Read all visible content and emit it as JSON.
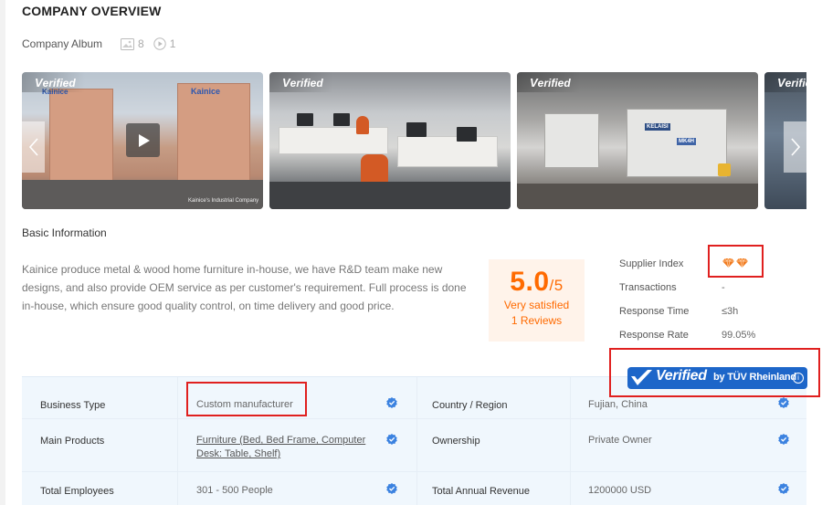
{
  "title": "COMPANY OVERVIEW",
  "album": {
    "label": "Company Album",
    "image_count": "8",
    "video_count": "1"
  },
  "gallery": {
    "verified_label_prefix": "V",
    "verified_label_rest": "erified",
    "photo1_sign": "Kainice",
    "photo1_caption": "Kainice's Industrial Company",
    "photo3_machine_label": "MK4H",
    "photo3_brand": "KELAISI"
  },
  "basic_info": {
    "label": "Basic Information",
    "description": "Kainice produce metal & wood home furniture in-house, we have R&D team make new designs, and also provide OEM service as per customer's requirement. Full process is done in-house, which ensure good quality control, on time delivery and good price."
  },
  "rating": {
    "score": "5.0",
    "out_of": "/5",
    "satisfaction": "Very satisfied",
    "reviews": "1 Reviews"
  },
  "metrics": {
    "supplier_index": "Supplier Index",
    "transactions": "Transactions",
    "transactions_value": "-",
    "response_time": "Response Time",
    "response_time_value": "≤3h",
    "response_rate": "Response Rate",
    "response_rate_value": "99.05%"
  },
  "tuv": {
    "verified": "Verified",
    "by": "by TÜV Rheinland",
    "info": "i"
  },
  "details": {
    "business_type_label": "Business Type",
    "business_type_value": "Custom manufacturer",
    "country_label": "Country / Region",
    "country_value": "Fujian, China",
    "main_products_label": "Main Products",
    "main_products_value_line1": "Furniture (Bed, Bed Frame, Computer",
    "main_products_value_line2": "Desk: Table, Shelf)",
    "ownership_label": "Ownership",
    "ownership_value": "Private Owner",
    "employees_label": "Total Employees",
    "employees_value": "301 - 500 People",
    "revenue_label": "Total Annual Revenue",
    "revenue_value": "1200000 USD"
  },
  "colors": {
    "accent": "#ff6a00",
    "verify_blue": "#1d66c9",
    "highlight_red": "#e0201f"
  }
}
